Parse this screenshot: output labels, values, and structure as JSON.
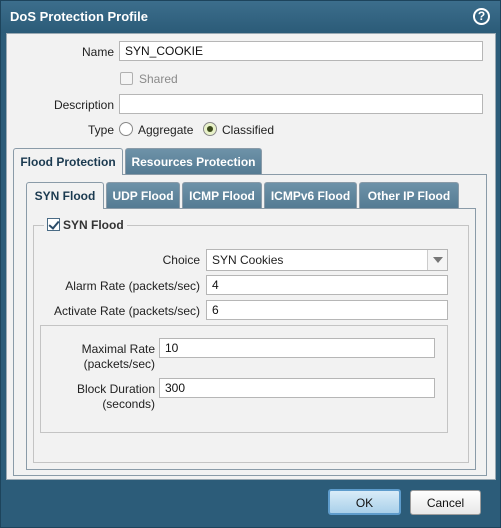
{
  "dialog": {
    "title": "DoS Protection Profile",
    "help_icon": "?"
  },
  "form": {
    "name_label": "Name",
    "name_value": "SYN_COOKIE",
    "shared_label": "Shared",
    "description_label": "Description",
    "description_value": "",
    "type_label": "Type",
    "type_options": [
      "Aggregate",
      "Classified"
    ],
    "type_selected": "Classified"
  },
  "outer_tabs": [
    {
      "label": "Flood Protection",
      "active": true
    },
    {
      "label": "Resources Protection",
      "active": false
    }
  ],
  "inner_tabs": [
    {
      "label": "SYN Flood",
      "active": true
    },
    {
      "label": "UDP Flood",
      "active": false
    },
    {
      "label": "ICMP Flood",
      "active": false
    },
    {
      "label": "ICMPv6 Flood",
      "active": false
    },
    {
      "label": "Other IP Flood",
      "active": false
    }
  ],
  "syn_flood": {
    "enabled_label": "SYN Flood",
    "enabled": true,
    "choice_label": "Choice",
    "choice_value": "SYN Cookies",
    "alarm_rate_label": "Alarm Rate (packets/sec)",
    "alarm_rate_value": "4",
    "activate_rate_label": "Activate Rate (packets/sec)",
    "activate_rate_value": "6",
    "maximal_rate_label_line1": "Maximal Rate",
    "maximal_rate_label_line2": "(packets/sec)",
    "maximal_rate_value": "10",
    "block_duration_label_line1": "Block Duration",
    "block_duration_label_line2": "(seconds)",
    "block_duration_value": "300"
  },
  "buttons": {
    "ok_label": "OK",
    "cancel_label": "Cancel"
  },
  "colors": {
    "titlebar": "#2b5b78",
    "accent": "#5e9ccc",
    "tab_inactive": "#557b93"
  }
}
